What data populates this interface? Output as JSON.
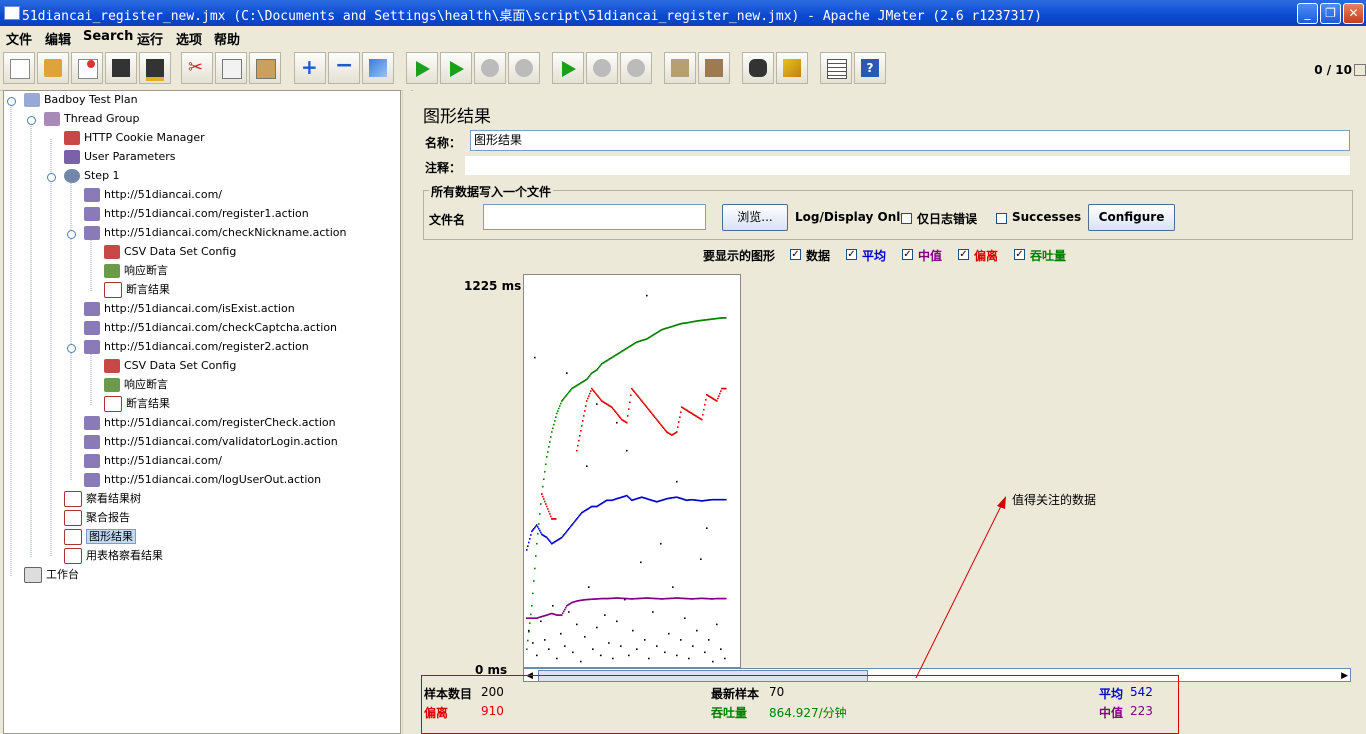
{
  "window": {
    "title": "51diancai_register_new.jmx (C:\\Documents and Settings\\health\\桌面\\script\\51diancai_register_new.jmx) - Apache JMeter (2.6 r1237317)",
    "min_glyph": "_",
    "max_glyph": "❐",
    "close_glyph": "✕"
  },
  "menu": [
    "文件",
    "编辑",
    "Search",
    "运行",
    "选项",
    "帮助"
  ],
  "toolbar": {
    "counter": "0 / 10"
  },
  "tree": {
    "nodes": [
      {
        "label": "Badboy Test Plan",
        "icon": "test-plan-icon"
      },
      {
        "label": "Thread Group",
        "icon": "thread-group-icon"
      },
      {
        "label": "HTTP Cookie Manager",
        "icon": "config-element-icon"
      },
      {
        "label": "User Parameters",
        "icon": "preprocessor-icon"
      },
      {
        "label": "Step 1",
        "icon": "controller-icon"
      },
      {
        "label": "http://51diancai.com/",
        "icon": "sampler-icon"
      },
      {
        "label": "http://51diancai.com/register1.action",
        "icon": "sampler-icon"
      },
      {
        "label": "http://51diancai.com/checkNickname.action",
        "icon": "sampler-icon"
      },
      {
        "label": "CSV Data Set Config",
        "icon": "config-element-icon"
      },
      {
        "label": "响应断言",
        "icon": "assertion-icon"
      },
      {
        "label": "断言结果",
        "icon": "listener-icon"
      },
      {
        "label": "http://51diancai.com/isExist.action",
        "icon": "sampler-icon"
      },
      {
        "label": "http://51diancai.com/checkCaptcha.action",
        "icon": "sampler-icon"
      },
      {
        "label": "http://51diancai.com/register2.action",
        "icon": "sampler-icon"
      },
      {
        "label": "CSV Data Set Config",
        "icon": "config-element-icon"
      },
      {
        "label": "响应断言",
        "icon": "assertion-icon"
      },
      {
        "label": "断言结果",
        "icon": "listener-icon"
      },
      {
        "label": "http://51diancai.com/registerCheck.action",
        "icon": "sampler-icon"
      },
      {
        "label": "http://51diancai.com/validatorLogin.action",
        "icon": "sampler-icon"
      },
      {
        "label": "http://51diancai.com/",
        "icon": "sampler-icon"
      },
      {
        "label": "http://51diancai.com/logUserOut.action",
        "icon": "sampler-icon"
      },
      {
        "label": "察看结果树",
        "icon": "listener-icon"
      },
      {
        "label": "聚合报告",
        "icon": "listener-icon"
      },
      {
        "label": "图形结果",
        "icon": "listener-icon"
      },
      {
        "label": "用表格察看结果",
        "icon": "listener-icon"
      },
      {
        "label": "工作台",
        "icon": "workbench-icon"
      }
    ]
  },
  "panel": {
    "heading": "图形结果",
    "name_label": "名称：",
    "name_value": "图形结果",
    "comment_label": "注释：",
    "comment_value": "",
    "file_group_title": "所有数据写入一个文件",
    "filename_label": "文件名",
    "filename_value": "",
    "browse_button": "浏览...",
    "log_display_label": "Log/Display Only:",
    "errors_only_label": "仅日志错误",
    "successes_label": "Successes",
    "configure_button": "Configure",
    "graphs_label": "要显示的图形",
    "graph_toggles": [
      {
        "label": "数据",
        "color": "#000000",
        "checked": true
      },
      {
        "label": "平均",
        "color": "#0000cc",
        "checked": true
      },
      {
        "label": "中值",
        "color": "#800080",
        "checked": true
      },
      {
        "label": "偏离",
        "color": "#dd0000",
        "checked": true
      },
      {
        "label": "吞吐量",
        "color": "#008000",
        "checked": true
      }
    ]
  },
  "chart_data": {
    "type": "scatter",
    "y_max_label": "1225 ms",
    "y_min_label": "0 ms",
    "ylim": [
      0,
      1225
    ],
    "x_samples": 200,
    "series": [
      {
        "name": "吞吐量",
        "color": "#008000",
        "values": [
          60,
          200,
          400,
          560,
          680,
          760,
          820,
          860,
          880,
          900,
          910,
          920,
          930,
          950,
          960,
          980,
          990,
          1000,
          1010,
          1020,
          1030,
          1040,
          1050,
          1055,
          1060,
          1070,
          1080,
          1090,
          1095,
          1100,
          1105,
          1110,
          1112,
          1115,
          1118,
          1120,
          1122,
          1124,
          1126,
          1128
        ]
      },
      {
        "name": "偏离",
        "color": "#dd0000",
        "values": [
          null,
          null,
          null,
          560,
          520,
          480,
          null,
          null,
          null,
          null,
          700,
          780,
          860,
          900,
          880,
          860,
          850,
          840,
          820,
          800,
          790,
          900,
          880,
          860,
          840,
          820,
          800,
          780,
          760,
          750,
          760,
          840,
          830,
          820,
          810,
          800,
          880,
          870,
          860,
          900
        ]
      },
      {
        "name": "平均",
        "color": "#0000cc",
        "values": [
          380,
          440,
          460,
          430,
          420,
          400,
          410,
          420,
          440,
          460,
          480,
          500,
          510,
          520,
          520,
          530,
          540,
          540,
          545,
          550,
          555,
          540,
          545,
          550,
          545,
          540,
          535,
          540,
          545,
          548,
          550,
          545,
          540,
          542,
          540,
          538,
          540,
          542,
          542,
          542
        ]
      },
      {
        "name": "中值",
        "color": "#800080",
        "values": [
          160,
          160,
          160,
          165,
          170,
          175,
          170,
          170,
          200,
          210,
          215,
          218,
          220,
          221,
          222,
          223,
          223,
          224,
          225,
          224,
          223,
          222,
          223,
          224,
          225,
          224,
          223,
          222,
          223,
          224,
          225,
          224,
          223,
          222,
          223,
          224,
          223,
          222,
          223,
          223
        ]
      }
    ],
    "scatter_points": [
      [
        2,
        120
      ],
      [
        6,
        80
      ],
      [
        10,
        40
      ],
      [
        14,
        150
      ],
      [
        18,
        90
      ],
      [
        22,
        60
      ],
      [
        26,
        200
      ],
      [
        30,
        30
      ],
      [
        34,
        110
      ],
      [
        38,
        70
      ],
      [
        42,
        180
      ],
      [
        46,
        50
      ],
      [
        50,
        140
      ],
      [
        54,
        20
      ],
      [
        58,
        100
      ],
      [
        62,
        260
      ],
      [
        66,
        60
      ],
      [
        70,
        130
      ],
      [
        74,
        40
      ],
      [
        78,
        170
      ],
      [
        82,
        80
      ],
      [
        86,
        30
      ],
      [
        90,
        150
      ],
      [
        94,
        70
      ],
      [
        98,
        220
      ],
      [
        102,
        40
      ],
      [
        106,
        120
      ],
      [
        110,
        60
      ],
      [
        114,
        340
      ],
      [
        118,
        90
      ],
      [
        122,
        30
      ],
      [
        126,
        180
      ],
      [
        130,
        70
      ],
      [
        134,
        400
      ],
      [
        138,
        50
      ],
      [
        142,
        110
      ],
      [
        146,
        260
      ],
      [
        150,
        40
      ],
      [
        154,
        90
      ],
      [
        158,
        160
      ],
      [
        162,
        30
      ],
      [
        166,
        70
      ],
      [
        170,
        120
      ],
      [
        174,
        350
      ],
      [
        178,
        50
      ],
      [
        182,
        90
      ],
      [
        186,
        20
      ],
      [
        190,
        140
      ],
      [
        194,
        60
      ],
      [
        198,
        30
      ],
      [
        8,
        1000
      ],
      [
        40,
        950
      ],
      [
        70,
        850
      ],
      [
        90,
        790
      ],
      [
        120,
        1200
      ],
      [
        150,
        600
      ],
      [
        180,
        450
      ],
      [
        100,
        700
      ],
      [
        60,
        650
      ]
    ]
  },
  "annotation": {
    "text": "值得关注的数据",
    "color": "#dd0000"
  },
  "stats": {
    "samples_label": "样本数目",
    "samples_value": "200",
    "latest_label": "最新样本",
    "latest_value": "70",
    "avg_label": "平均",
    "avg_value": "542",
    "dev_label": "偏离",
    "dev_value": "910",
    "throughput_label": "吞吐量",
    "throughput_value": "864.927/分钟",
    "median_label": "中值",
    "median_value": "223"
  }
}
